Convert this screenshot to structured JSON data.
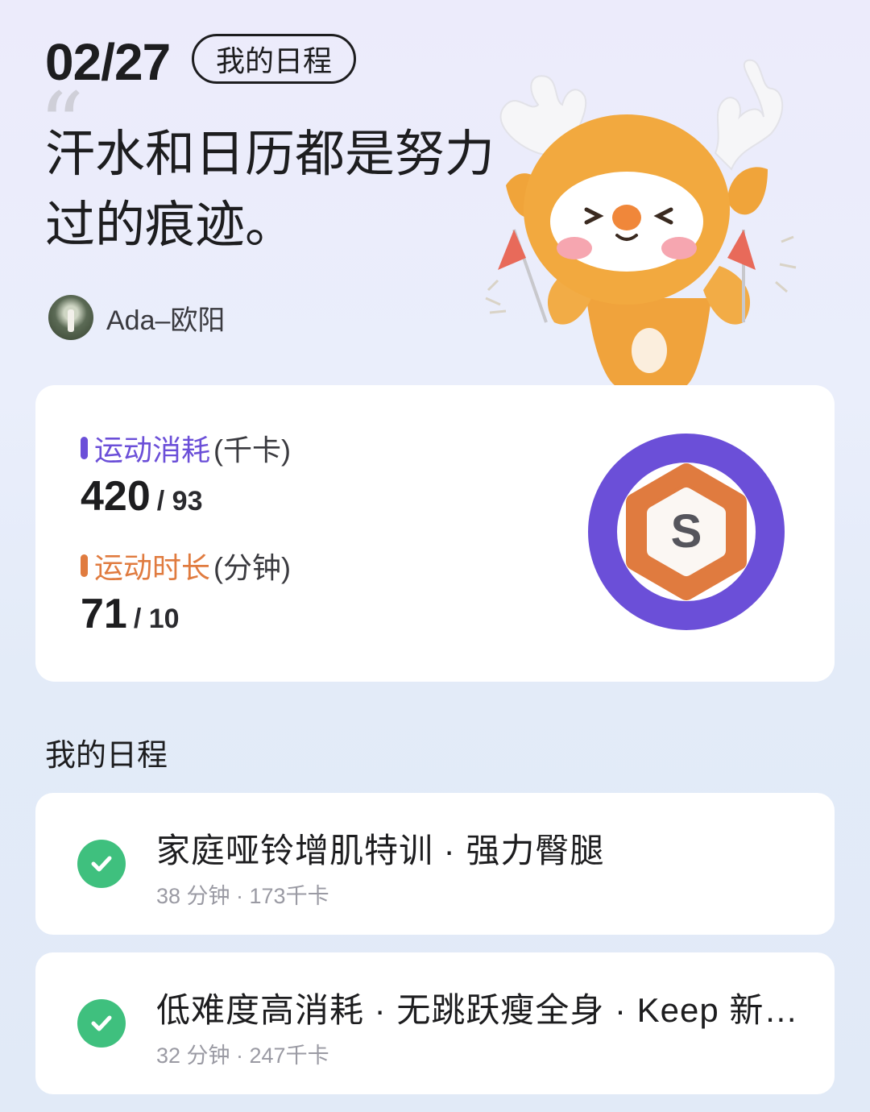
{
  "header": {
    "date": "02/27",
    "schedule_pill": "我的日程",
    "quote_mark": "“",
    "quote": "汗水和日历都是努力过的痕迹。",
    "username": "Ada–欧阳"
  },
  "stats": {
    "calories": {
      "label": "运动消耗",
      "unit": "(千卡)",
      "value": "420",
      "goal": "/ 93",
      "color": "#6b4fd8"
    },
    "duration": {
      "label": "运动时长",
      "unit": "(分钟)",
      "value": "71",
      "goal": "/ 10",
      "color": "#e07b3f"
    },
    "badge_letter": "S"
  },
  "schedule": {
    "title": "我的日程",
    "tasks": [
      {
        "title": "家庭哑铃增肌特训 · 强力臀腿",
        "meta": "38 分钟 · 173千卡",
        "done": true
      },
      {
        "title": "低难度高消耗 · 无跳跃瘦全身 · Keep 新…",
        "meta": "32 分钟 · 247千卡",
        "done": true
      }
    ]
  },
  "colors": {
    "accent_purple": "#6b4fd8",
    "accent_orange": "#e07b3f",
    "check_green": "#3fc07e"
  }
}
